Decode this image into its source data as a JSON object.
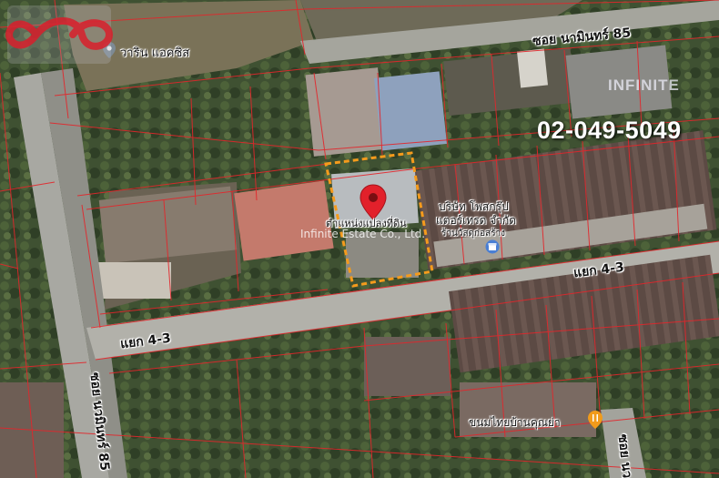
{
  "map": {
    "type": "satellite-imagery-with-parcel-lines",
    "parcel_line_color": "#e3262b",
    "highlight_color": "#f59b1c",
    "pin_color": "#e2212b"
  },
  "labels": {
    "soi_top": "ซอย นามินทร์ 85",
    "branch_right": "แยก 4-3",
    "branch_left": "แยก 4-3",
    "soi_vertical": "ซอย นวมินทร์ 85",
    "soi_bottom_right": "ซอย นว",
    "poi_top": "วาริน แอคซิส",
    "company_line1": "บริษัท โพสกรุ๊ป",
    "company_line2": "แตอร์เทรด จำกัด",
    "company_line3": "ร้านวัสดุก่อสร้าง",
    "parcel_label": "ตำแหน่งแปลงที่ดิน",
    "shop_bottom": "ขนมไทยบ้านคุณย่า"
  },
  "watermark": "Infinite Estate Co., Ltd.",
  "brand": {
    "phone": "02-049-5049",
    "logo_text": "INFINITE",
    "logo_color": "#d81e2c"
  },
  "icons": {
    "poi_pin": "place-pin-icon",
    "location_pin": "location-pin-icon",
    "shop": "shop-icon",
    "food": "food-icon"
  }
}
